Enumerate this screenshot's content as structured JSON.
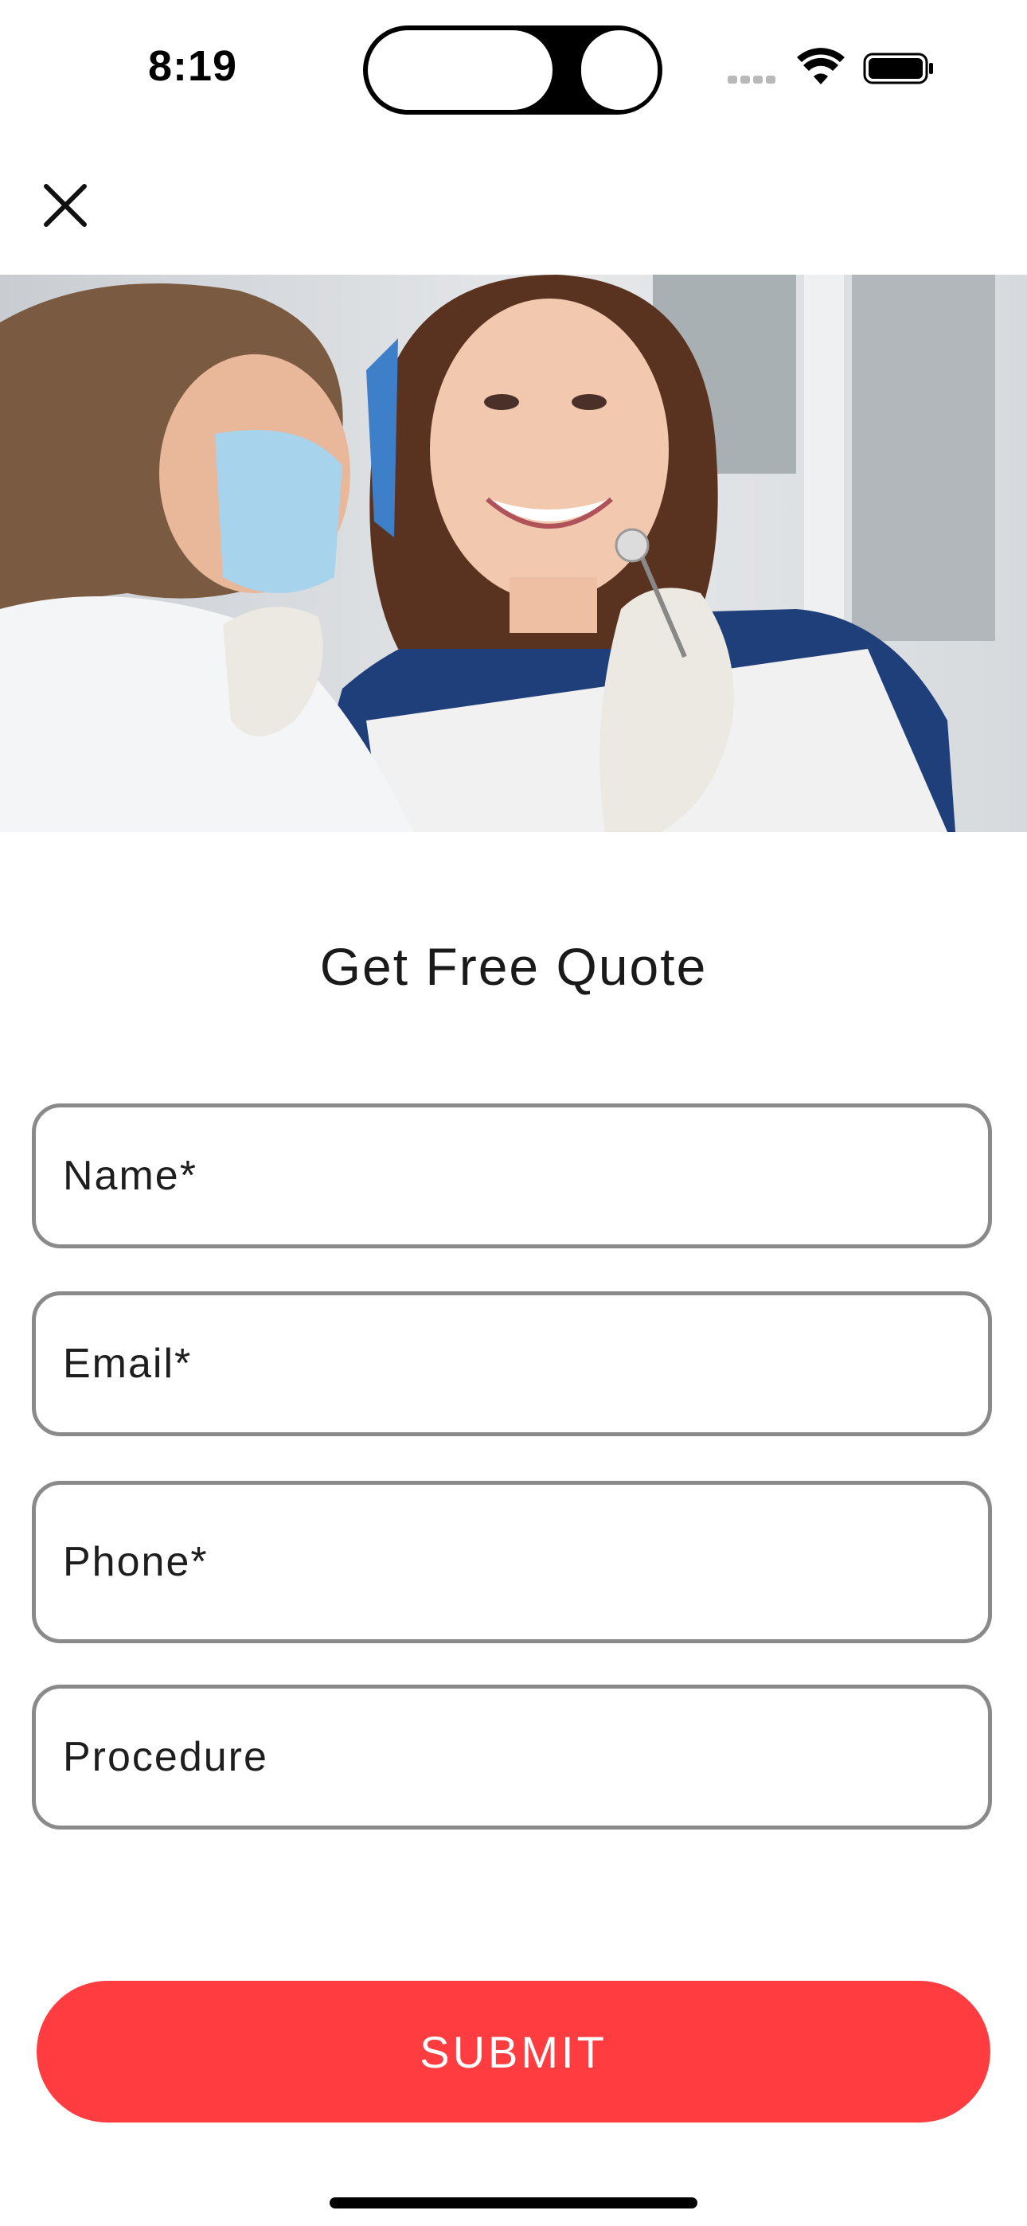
{
  "status_bar": {
    "time": "8:19",
    "icons": [
      "cellular-signal-icon",
      "wifi-icon",
      "battery-icon"
    ]
  },
  "header": {
    "close_icon": "close-icon"
  },
  "hero": {
    "subject": "dentist-with-smiling-patient-photo"
  },
  "form": {
    "title": "Get Free Quote",
    "fields": [
      {
        "label": "Name*"
      },
      {
        "label": "Email*"
      },
      {
        "label": "Phone*"
      },
      {
        "label": "Procedure"
      }
    ],
    "submit_label": "SUBMIT"
  },
  "colors": {
    "accent": "#ff3d40",
    "field_border": "#8a8a8a",
    "background": "#ffffff"
  }
}
